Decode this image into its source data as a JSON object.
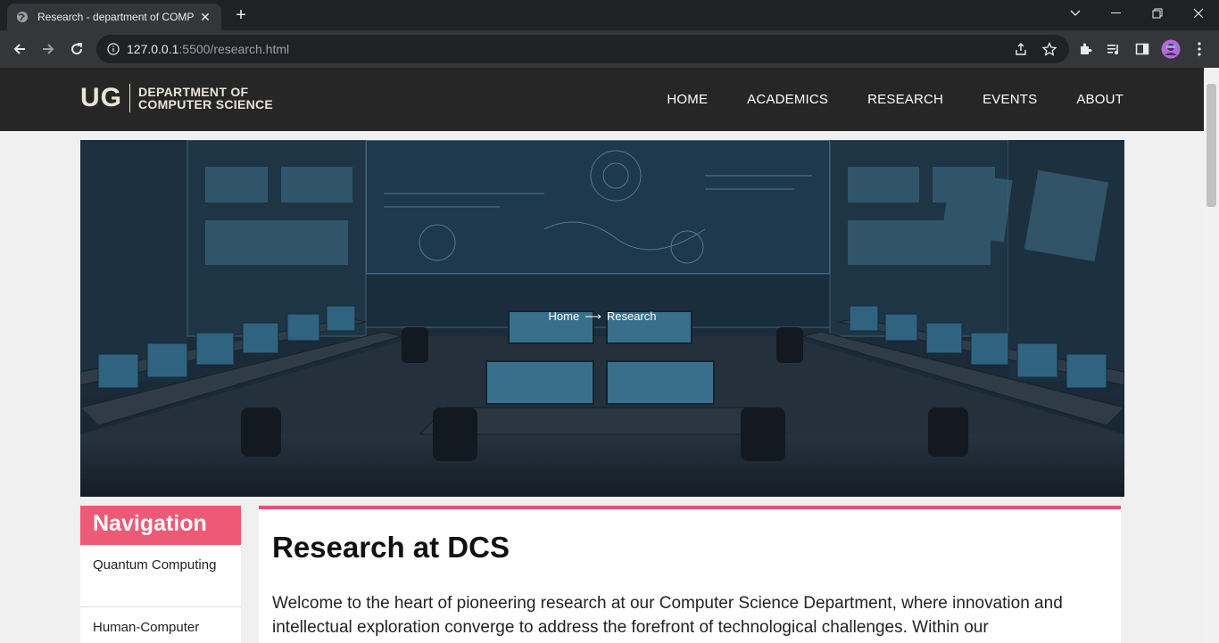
{
  "browser": {
    "tab_title": "Research - department of COMP",
    "url_host": "127.0.0.1",
    "url_path": ":5500/research.html"
  },
  "site": {
    "logo_mark": "UG",
    "logo_line1": "DEPARTMENT OF",
    "logo_line2": "COMPUTER SCIENCE",
    "menu": [
      "HOME",
      "ACADEMICS",
      "RESEARCH",
      "EVENTS",
      "ABOUT"
    ]
  },
  "hero": {
    "crumb_home": "Home",
    "crumb_arrow": "⟶",
    "crumb_current": "Research"
  },
  "sidebar": {
    "heading": "Navigation",
    "items": [
      "Quantum Computing",
      "Human-Computer"
    ]
  },
  "main": {
    "title": "Research at DCS",
    "intro": "Welcome to the heart of pioneering research at our Computer Science Department, where innovation and intellectual exploration converge to address the forefront of technological challenges. Within our"
  },
  "colors": {
    "accent": "#ec5a75",
    "header_bg": "#262626"
  }
}
